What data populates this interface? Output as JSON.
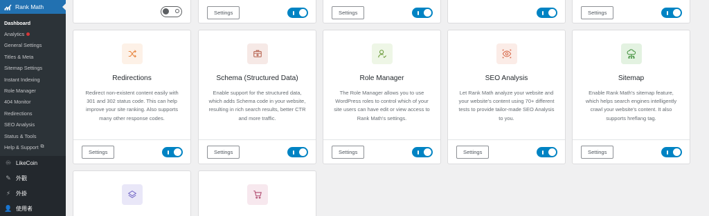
{
  "sidebar": {
    "brand": "Rank Math",
    "items": [
      {
        "label": "Dashboard",
        "current": true
      },
      {
        "label": "Analytics",
        "badge": true
      },
      {
        "label": "General Settings"
      },
      {
        "label": "Titles & Meta"
      },
      {
        "label": "Sitemap Settings"
      },
      {
        "label": "Instant Indexing"
      },
      {
        "label": "Role Manager"
      },
      {
        "label": "404 Monitor"
      },
      {
        "label": "Redirections"
      },
      {
        "label": "SEO Analysis"
      },
      {
        "label": "Status & Tools"
      },
      {
        "label": "Help & Support",
        "external": true
      }
    ],
    "menu": [
      {
        "label": "LikeCoin",
        "icon": "likecoin-icon"
      },
      {
        "label": "外觀",
        "icon": "appearance-icon"
      },
      {
        "label": "外掛",
        "icon": "plugins-icon"
      },
      {
        "label": "使用者",
        "icon": "users-icon"
      }
    ]
  },
  "settings_label": "Settings",
  "top_row_buttons": [
    false,
    true,
    true,
    false,
    true
  ],
  "top_row_toggles": [
    "off",
    "on",
    "on",
    "on",
    "on"
  ],
  "modules": [
    {
      "title": "Redirections",
      "desc": "Redirect non-existent content easily with 301 and 302 status code. This can help improve your site ranking. Also supports many other response codes.",
      "icon": "shuffle-icon",
      "icon_bg": "#fdf1e7",
      "icon_color": "#e88844",
      "enabled": true
    },
    {
      "title": "Schema (Structured Data)",
      "desc": "Enable support for the structured data, which adds Schema code in your website, resulting in rich search results, better CTR and more traffic.",
      "icon": "schema-icon",
      "icon_bg": "#f6e9e6",
      "icon_color": "#b5604c",
      "enabled": true
    },
    {
      "title": "Role Manager",
      "desc": "The Role Manager allows you to use WordPress roles to control which of your site users can have edit or view access to Rank Math's settings.",
      "icon": "user-check-icon",
      "icon_bg": "#eef6e6",
      "icon_color": "#6c9b3a",
      "enabled": true
    },
    {
      "title": "SEO Analysis",
      "desc": "Let Rank Math analyze your website and your website's content using 70+ different tests to provide tailor-made SEO Analysis to you.",
      "icon": "eye-icon",
      "icon_bg": "#fbece7",
      "icon_color": "#d86a4b",
      "enabled": true
    },
    {
      "title": "Sitemap",
      "desc": "Enable Rank Math's sitemap feature, which helps search engines intelligently crawl your website's content. It also supports hreflang tag.",
      "icon": "sitemap-cloud-icon",
      "icon_bg": "#e3f2e1",
      "icon_color": "#3f8f3a",
      "enabled": true
    }
  ],
  "bottom_row": [
    {
      "icon": "layers-icon",
      "icon_bg": "#e9e7f8",
      "icon_color": "#6e63c4"
    },
    {
      "icon": "cart-icon",
      "icon_bg": "#f7e8ee",
      "icon_color": "#b04a6f"
    }
  ]
}
